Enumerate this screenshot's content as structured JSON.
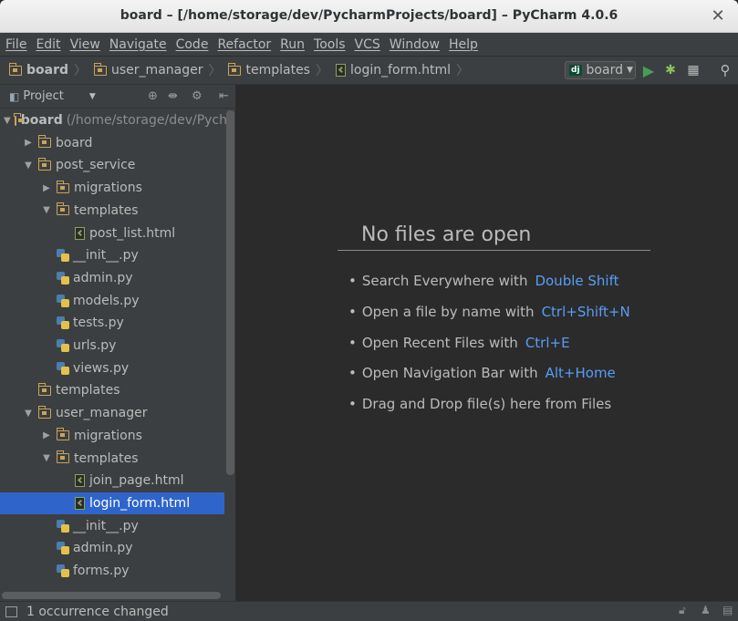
{
  "window": {
    "title": "board – [/home/storage/dev/PycharmProjects/board] – PyCharm 4.0.6"
  },
  "menu": [
    "File",
    "Edit",
    "View",
    "Navigate",
    "Code",
    "Refactor",
    "Run",
    "Tools",
    "VCS",
    "Window",
    "Help"
  ],
  "breadcrumbs": [
    "board",
    "user_manager",
    "templates",
    "login_form.html"
  ],
  "run_config": {
    "badge": "dj",
    "label": "board"
  },
  "icons": {
    "run": "play-icon",
    "debug": "bug-icon",
    "coverage": "coverage-icon",
    "search": "search-icon",
    "folder": "folder-icon",
    "python_file": "python-file-icon",
    "html_file": "html-file-icon"
  },
  "project_panel": {
    "title": "Project",
    "tree": [
      {
        "label": "board",
        "path": "(/home/storage/dev/Pych",
        "type": "folder",
        "depth": 0,
        "expanded": true,
        "bold": true
      },
      {
        "label": "board",
        "type": "folder",
        "depth": 1,
        "expanded": false
      },
      {
        "label": "post_service",
        "type": "folder",
        "depth": 1,
        "expanded": true
      },
      {
        "label": "migrations",
        "type": "folder",
        "depth": 2,
        "expanded": false
      },
      {
        "label": "templates",
        "type": "folder",
        "depth": 2,
        "expanded": true
      },
      {
        "label": "post_list.html",
        "type": "html",
        "depth": 3
      },
      {
        "label": "__init__.py",
        "type": "py",
        "depth": 2
      },
      {
        "label": "admin.py",
        "type": "py",
        "depth": 2
      },
      {
        "label": "models.py",
        "type": "py",
        "depth": 2
      },
      {
        "label": "tests.py",
        "type": "py",
        "depth": 2
      },
      {
        "label": "urls.py",
        "type": "py",
        "depth": 2
      },
      {
        "label": "views.py",
        "type": "py",
        "depth": 2
      },
      {
        "label": "templates",
        "type": "folder",
        "depth": 1
      },
      {
        "label": "user_manager",
        "type": "folder",
        "depth": 1,
        "expanded": true
      },
      {
        "label": "migrations",
        "type": "folder",
        "depth": 2,
        "expanded": false
      },
      {
        "label": "templates",
        "type": "folder",
        "depth": 2,
        "expanded": true
      },
      {
        "label": "join_page.html",
        "type": "html",
        "depth": 3
      },
      {
        "label": "login_form.html",
        "type": "html",
        "depth": 3,
        "selected": true
      },
      {
        "label": "__init__.py",
        "type": "py",
        "depth": 2
      },
      {
        "label": "admin.py",
        "type": "py",
        "depth": 2
      },
      {
        "label": "forms.py",
        "type": "py",
        "depth": 2
      }
    ]
  },
  "editor": {
    "empty_title": "No files are open",
    "tips": [
      {
        "text": "Search Everywhere with",
        "key": "Double Shift"
      },
      {
        "text": "Open a file by name with",
        "key": "Ctrl+Shift+N"
      },
      {
        "text": "Open Recent Files with",
        "key": "Ctrl+E"
      },
      {
        "text": "Open Navigation Bar with",
        "key": "Alt+Home"
      },
      {
        "text": "Drag and Drop file(s) here from Files",
        "key": ""
      }
    ]
  },
  "status": {
    "message": "1 occurrence changed"
  },
  "colors": {
    "accent": "#2f65ca",
    "link": "#589df6",
    "panel": "#3c3f41",
    "editor": "#2b2b2b"
  }
}
